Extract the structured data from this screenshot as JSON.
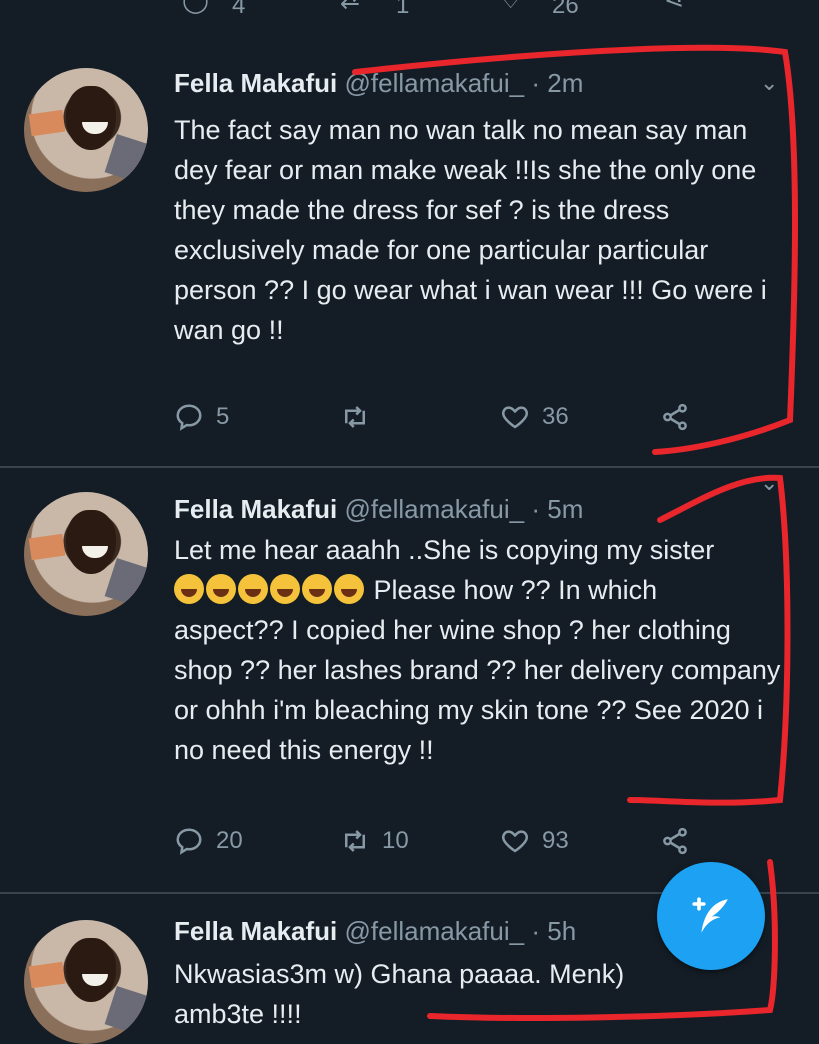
{
  "top_actions": {
    "reply_count": "4",
    "retweet_count": "1",
    "like_count": "26"
  },
  "tweets": [
    {
      "name": "Fella Makafui",
      "handle": "@fellamakafui_",
      "dot": "·",
      "time": "2m",
      "text": "The fact say man no wan talk no mean say man dey fear or man make weak !!Is she the only one they made the dress for sef ? is the dress exclusively made for one particular particular person ?? I go wear what i wan wear !!! Go were i wan go !!",
      "replies": "5",
      "retweets": "",
      "likes": "36"
    },
    {
      "name": "Fella Makafui",
      "handle": "@fellamakafui_",
      "dot": "·",
      "time": "5m",
      "text_line1": "Let me hear aaahh ..She is copying my sister",
      "text_line2": " Please how ?? In which",
      "text_rest": "aspect?? I copied her wine shop ? her clothing shop ?? her lashes brand ?? her delivery company or ohhh i'm bleaching my skin tone ?? See 2020 i no need this energy !!",
      "emoji_name": "rolling-on-the-floor-laughing",
      "replies": "20",
      "retweets": "10",
      "likes": "93"
    },
    {
      "name": "Fella Makafui",
      "handle": "@fellamakafui_",
      "dot": "·",
      "time": "5h",
      "text": "Nkwasias3m w) Ghana paaaa. Menk)\namb3te !!!!"
    }
  ],
  "colors": {
    "background": "#141d26",
    "text": "#e6ecf0",
    "muted": "#8899a6",
    "fab": "#1da1f2",
    "annotation": "#e8262b"
  },
  "icons": {
    "reply": "reply-icon",
    "retweet": "retweet-icon",
    "like": "heart-icon",
    "share": "share-icon",
    "compose": "compose-tweet-icon",
    "chevron": "chevron-down-icon"
  }
}
